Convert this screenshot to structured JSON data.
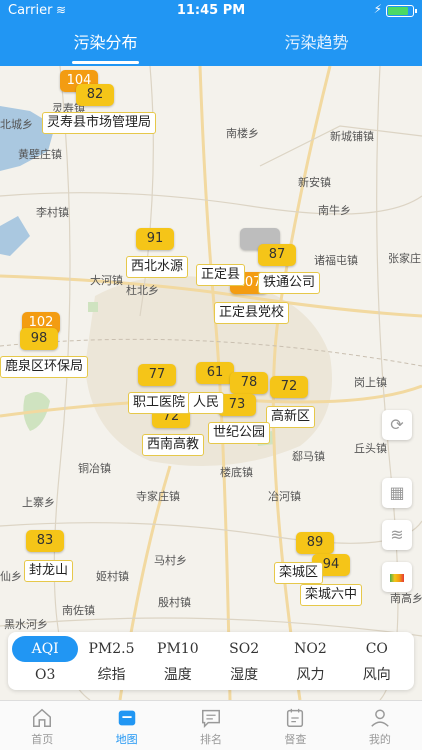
{
  "status_bar": {
    "carrier": "Carrier",
    "time": "11:45 PM"
  },
  "tabs": [
    {
      "label": "污染分布",
      "active": true
    },
    {
      "label": "污染趋势",
      "active": false
    }
  ],
  "map": {
    "places": [
      "灵寿镇",
      "南楼乡",
      "北城乡",
      "北城镇",
      "黄壁庄镇",
      "新城铺镇",
      "新安镇",
      "李村镇",
      "南牛乡",
      "诸福屯镇",
      "张家庄",
      "大河镇",
      "杜北乡",
      "铜冶镇",
      "上寨乡",
      "寺家庄镇",
      "楼底镇",
      "冶河镇",
      "郄马镇",
      "丘头镇",
      "岗上镇",
      "马村乡",
      "姬村镇",
      "殷村镇",
      "南佐镇",
      "仙乡",
      "黑水河乡",
      "南高乡",
      "赵陵铺乡",
      "安乡",
      "县乡"
    ],
    "markers": [
      {
        "aqi": "104",
        "level": "orange"
      },
      {
        "aqi": "82",
        "level": "yellow"
      },
      {
        "aqi": "91",
        "level": "yellow"
      },
      {
        "aqi": "87",
        "level": "yellow"
      },
      {
        "aqi": "107",
        "level": "orange"
      },
      {
        "aqi": "102",
        "level": "orange"
      },
      {
        "aqi": "98",
        "level": "yellow"
      },
      {
        "aqi": "77",
        "level": "yellow"
      },
      {
        "aqi": "61",
        "level": "yellow"
      },
      {
        "aqi": "78",
        "level": "yellow"
      },
      {
        "aqi": "72",
        "level": "yellow"
      },
      {
        "aqi": "72",
        "level": "yellow"
      },
      {
        "aqi": "73",
        "level": "yellow"
      },
      {
        "aqi": "83",
        "level": "yellow"
      },
      {
        "aqi": "89",
        "level": "yellow"
      },
      {
        "aqi": "94",
        "level": "yellow"
      }
    ],
    "stations": [
      "灵寿县市场管理局",
      "西北水源",
      "正定县",
      "铁通公司",
      "正定县党校",
      "鹿泉区环保局",
      "职工医院",
      "人民",
      "高新区",
      "西南高教",
      "世纪公园",
      "封龙山",
      "栾城区",
      "栾城六中"
    ]
  },
  "pollutants": {
    "row1": [
      "AQI",
      "PM2.5",
      "PM10",
      "SO2",
      "NO2",
      "CO"
    ],
    "row2": [
      "O3",
      "综指",
      "温度",
      "湿度",
      "风力",
      "风向"
    ],
    "selected": "AQI"
  },
  "nav": [
    {
      "label": "首页",
      "icon": "home-icon"
    },
    {
      "label": "地图",
      "icon": "map-icon",
      "active": true
    },
    {
      "label": "排名",
      "icon": "ranking-icon"
    },
    {
      "label": "督查",
      "icon": "inspection-icon"
    },
    {
      "label": "我的",
      "icon": "profile-icon"
    }
  ],
  "colors": {
    "primary": "#2196f3",
    "aqi_yellow": "#f5c518",
    "aqi_orange": "#f39c12"
  }
}
